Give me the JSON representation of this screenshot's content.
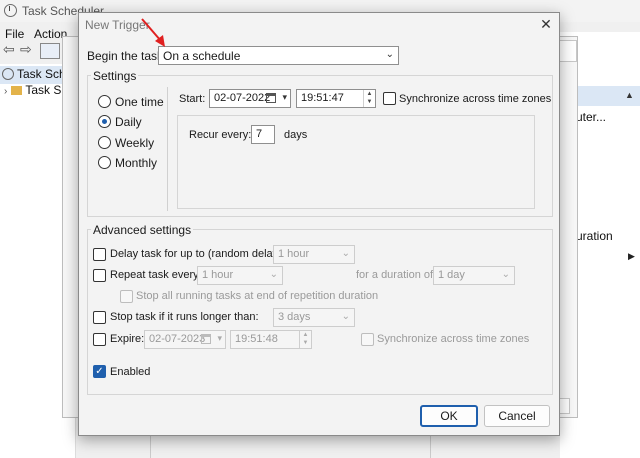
{
  "background": {
    "title": "Task Scheduler",
    "menu": [
      "File",
      "Action"
    ],
    "tree": [
      "Task Scheduler",
      "Task S"
    ],
    "right_pane": [
      "uter...",
      "uration"
    ]
  },
  "dialog": {
    "title": "New Trigger",
    "begin_label": "Begin the task:",
    "begin_value": "On a schedule",
    "settings_legend": "Settings",
    "radios": [
      "One time",
      "Daily",
      "Weekly",
      "Monthly"
    ],
    "selected_radio": "Daily",
    "start_label": "Start:",
    "start_date": "02-07-2022",
    "start_time": "19:51:47",
    "sync_label": "Synchronize across time zones",
    "recur_label": "Recur every:",
    "recur_value": "7",
    "recur_unit": "days",
    "advanced_legend": "Advanced settings",
    "delay_label": "Delay task for up to (random delay):",
    "delay_value": "1 hour",
    "repeat_label": "Repeat task every:",
    "repeat_value": "1 hour",
    "duration_label": "for a duration of:",
    "duration_value": "1 day",
    "stop_running_label": "Stop all running tasks at end of repetition duration",
    "stop_longer_label": "Stop task if it runs longer than:",
    "stop_longer_value": "3 days",
    "expire_label": "Expire:",
    "expire_date": "02-07-2023",
    "expire_time": "19:51:48",
    "expire_sync_label": "Synchronize across time zones",
    "enabled_label": "Enabled",
    "ok_label": "OK",
    "cancel_label": "Cancel"
  },
  "colors": {
    "accent": "#1f5fad",
    "annotation_arrow": "#e02020"
  }
}
